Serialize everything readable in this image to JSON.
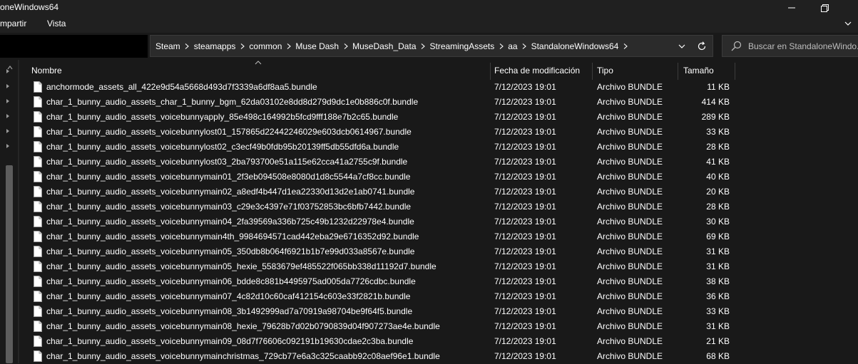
{
  "window": {
    "title": "oneWindows64"
  },
  "menu": {
    "items": [
      "mpartir",
      "Vista"
    ]
  },
  "breadcrumbs": [
    "Steam",
    "steamapps",
    "common",
    "Muse Dash",
    "MuseDash_Data",
    "StreamingAssets",
    "aa",
    "StandaloneWindows64"
  ],
  "search": {
    "placeholder": "Buscar en StandaloneWindo..."
  },
  "columns": {
    "name": "Nombre",
    "date": "Fecha de modificación",
    "type": "Tipo",
    "size": "Tamaño"
  },
  "colors": {
    "background": "#191919",
    "chrome": "#202020",
    "address_bg": "#2b2b2b",
    "text": "#ffffff",
    "scroll_thumb": "#5c5c5c"
  },
  "files": [
    {
      "name": "anchormode_assets_all_422e9d54a5668d493d7f3339a6df8aa5.bundle",
      "date": "7/12/2023 19:01",
      "type": "Archivo BUNDLE",
      "size": "11 KB"
    },
    {
      "name": "char_1_bunny_audio_assets_char_1_bunny_bgm_62da03102e8dd8d279d9dc1e0b886c0f.bundle",
      "date": "7/12/2023 19:01",
      "type": "Archivo BUNDLE",
      "size": "414 KB"
    },
    {
      "name": "char_1_bunny_audio_assets_voicebunnyapply_85e498c164992b5fcd9fff188e7b2c65.bundle",
      "date": "7/12/2023 19:01",
      "type": "Archivo BUNDLE",
      "size": "289 KB"
    },
    {
      "name": "char_1_bunny_audio_assets_voicebunnylost01_157865d22442246029e603dcb0614967.bundle",
      "date": "7/12/2023 19:01",
      "type": "Archivo BUNDLE",
      "size": "33 KB"
    },
    {
      "name": "char_1_bunny_audio_assets_voicebunnylost02_c3ecf49b0fdb95b20139ff5db55dfd6a.bundle",
      "date": "7/12/2023 19:01",
      "type": "Archivo BUNDLE",
      "size": "28 KB"
    },
    {
      "name": "char_1_bunny_audio_assets_voicebunnylost03_2ba793700e51a115e62cca41a2755c9f.bundle",
      "date": "7/12/2023 19:01",
      "type": "Archivo BUNDLE",
      "size": "41 KB"
    },
    {
      "name": "char_1_bunny_audio_assets_voicebunnymain01_2f3eb094508e8080d1d8c5544a7cf8cc.bundle",
      "date": "7/12/2023 19:01",
      "type": "Archivo BUNDLE",
      "size": "40 KB"
    },
    {
      "name": "char_1_bunny_audio_assets_voicebunnymain02_a8edf4b447d1ea22330d13d2e1ab0741.bundle",
      "date": "7/12/2023 19:01",
      "type": "Archivo BUNDLE",
      "size": "20 KB"
    },
    {
      "name": "char_1_bunny_audio_assets_voicebunnymain03_c29e3c4397e71f03752853bc6bfb7442.bundle",
      "date": "7/12/2023 19:01",
      "type": "Archivo BUNDLE",
      "size": "28 KB"
    },
    {
      "name": "char_1_bunny_audio_assets_voicebunnymain04_2fa39569a336b725c49b1232d22978e4.bundle",
      "date": "7/12/2023 19:01",
      "type": "Archivo BUNDLE",
      "size": "30 KB"
    },
    {
      "name": "char_1_bunny_audio_assets_voicebunnymain4th_9984694571cad442eba29e6716352d92.bundle",
      "date": "7/12/2023 19:01",
      "type": "Archivo BUNDLE",
      "size": "69 KB"
    },
    {
      "name": "char_1_bunny_audio_assets_voicebunnymain05_350db8b064f6921b1b7e99d033a8567e.bundle",
      "date": "7/12/2023 19:01",
      "type": "Archivo BUNDLE",
      "size": "31 KB"
    },
    {
      "name": "char_1_bunny_audio_assets_voicebunnymain05_hexie_5583679ef485522f065bb338d11192d7.bundle",
      "date": "7/12/2023 19:01",
      "type": "Archivo BUNDLE",
      "size": "31 KB"
    },
    {
      "name": "char_1_bunny_audio_assets_voicebunnymain06_bdde8c881b4495975ad005da7726cdbc.bundle",
      "date": "7/12/2023 19:01",
      "type": "Archivo BUNDLE",
      "size": "38 KB"
    },
    {
      "name": "char_1_bunny_audio_assets_voicebunnymain07_4c82d10c60caf412154c603e33f2821b.bundle",
      "date": "7/12/2023 19:01",
      "type": "Archivo BUNDLE",
      "size": "36 KB"
    },
    {
      "name": "char_1_bunny_audio_assets_voicebunnymain08_3b1492999ad7a70919a98704be9f64f5.bundle",
      "date": "7/12/2023 19:01",
      "type": "Archivo BUNDLE",
      "size": "33 KB"
    },
    {
      "name": "char_1_bunny_audio_assets_voicebunnymain08_hexie_79628b7d02b0790839d04f907273ae4e.bundle",
      "date": "7/12/2023 19:01",
      "type": "Archivo BUNDLE",
      "size": "31 KB"
    },
    {
      "name": "char_1_bunny_audio_assets_voicebunnymain09_08d7f76606c092191b19630cdae2c3ba.bundle",
      "date": "7/12/2023 19:01",
      "type": "Archivo BUNDLE",
      "size": "21 KB"
    },
    {
      "name": "char_1_bunny_audio_assets_voicebunnymainchristmas_729cb77e6a3c325caabb92c08aef96e1.bundle",
      "date": "7/12/2023 19:01",
      "type": "Archivo BUNDLE",
      "size": "68 KB"
    }
  ]
}
